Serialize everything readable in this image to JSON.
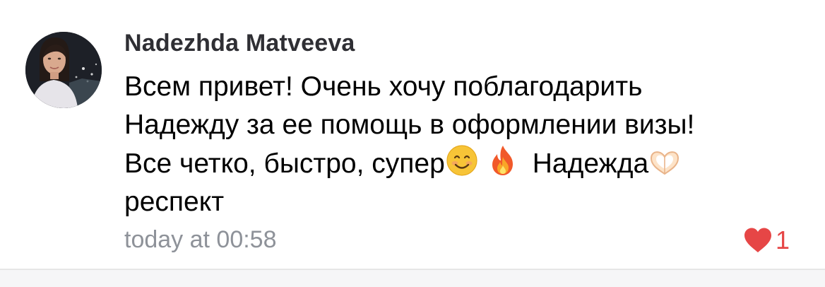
{
  "comment": {
    "author": "Nadezhda Matveeva",
    "text_lines": [
      "Всем привет! Очень хочу поблагодарить",
      "Надежду за ее помощь в оформлении визы!",
      "Все четко, быстро, супер",
      "Надежда",
      "респект"
    ],
    "emojis": [
      "smiling-face-emoji",
      "fire-emoji",
      "heart-hands-emoji"
    ],
    "timestamp": "today at 00:58",
    "like_count": "1",
    "icons": {
      "like": "heart-icon",
      "avatar": "user-avatar-photo"
    }
  },
  "colors": {
    "author": "#2f2f34",
    "text": "#000000",
    "timestamp": "#8e9299",
    "like": "#e64646",
    "divider": "#e6e6e6"
  }
}
